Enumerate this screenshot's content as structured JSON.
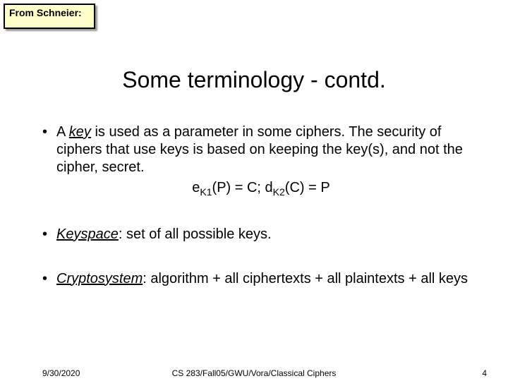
{
  "callout": {
    "label": "From Schneier:"
  },
  "title": "Some terminology - contd.",
  "bullets": {
    "b1_pre": "A ",
    "b1_key": "key",
    "b1_post": " is used as a parameter in some ciphers. The security of ciphers that use keys is based on keeping the key(s), and not the cipher, secret.",
    "formula_e": "e",
    "formula_k1": "K1",
    "formula_mid1": "(P) = C; d",
    "formula_k2": "K2",
    "formula_end": "(C) = P",
    "b2_term": "Keyspace",
    "b2_rest": ": set of all possible keys.",
    "b3_term": "Cryptosystem",
    "b3_rest": ": algorithm + all ciphertexts + all plaintexts + all keys"
  },
  "footer": {
    "date": "9/30/2020",
    "center": "CS 283/Fall05/GWU/Vora/Classical Ciphers",
    "page": "4"
  }
}
